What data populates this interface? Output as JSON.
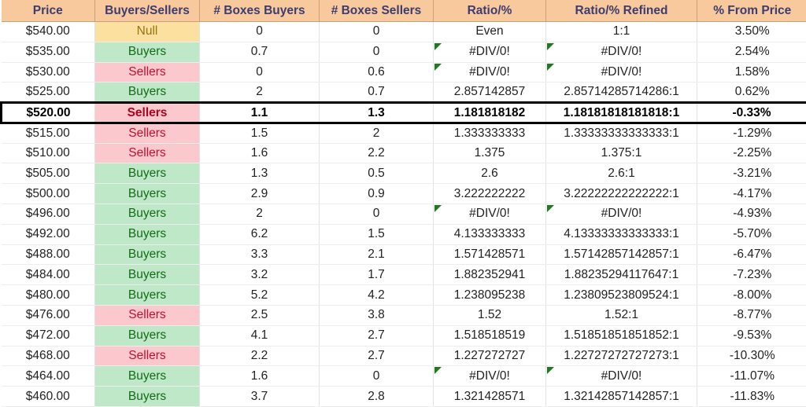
{
  "sheet": {
    "title": "Price Ladder Buyers/Sellers Ratio Table",
    "colors": {
      "header_bg": "#F8C99C",
      "header_text": "#3C3C70",
      "buyers_bg": "#BFE8C8",
      "buyers_text": "#136B16",
      "sellers_bg": "#FBC9CD",
      "sellers_text": "#C01030",
      "null_bg": "#FBE0A0",
      "null_text": "#97750E",
      "error_flag": "#1D7A1D",
      "highlight_border": "#000000"
    }
  },
  "columns": [
    {
      "key": "price",
      "label": "Price"
    },
    {
      "key": "side",
      "label": "Buyers/Sellers"
    },
    {
      "key": "boxes_buy",
      "label": "# Boxes Buyers"
    },
    {
      "key": "boxes_sell",
      "label": "# Boxes Sellers"
    },
    {
      "key": "ratio",
      "label": "Ratio/%"
    },
    {
      "key": "ratio_ref",
      "label": "Ratio/% Refined"
    },
    {
      "key": "from_price",
      "label": "% From Price"
    }
  ],
  "rows": [
    {
      "price": "$540.00",
      "side": "Null",
      "side_fill": "null",
      "boxes_buy": "0",
      "boxes_sell": "0",
      "ratio": "Even",
      "ratio_error": false,
      "ratio_ref": "1:1",
      "ratio_ref_error": false,
      "from_price": "3.50%",
      "highlight": false
    },
    {
      "price": "$535.00",
      "side": "Buyers",
      "side_fill": "buyers",
      "boxes_buy": "0.7",
      "boxes_sell": "0",
      "ratio": "#DIV/0!",
      "ratio_error": true,
      "ratio_ref": "#DIV/0!",
      "ratio_ref_error": true,
      "from_price": "2.54%",
      "highlight": false
    },
    {
      "price": "$530.00",
      "side": "Sellers",
      "side_fill": "sellers",
      "boxes_buy": "0",
      "boxes_sell": "0.6",
      "ratio": "#DIV/0!",
      "ratio_error": true,
      "ratio_ref": "#DIV/0!",
      "ratio_ref_error": true,
      "from_price": "1.58%",
      "highlight": false
    },
    {
      "price": "$525.00",
      "side": "Buyers",
      "side_fill": "buyers",
      "boxes_buy": "2",
      "boxes_sell": "0.7",
      "ratio": "2.857142857",
      "ratio_error": false,
      "ratio_ref": "2.85714285714286:1",
      "ratio_ref_error": false,
      "from_price": "0.62%",
      "highlight": false
    },
    {
      "price": "$520.00",
      "side": "Sellers",
      "side_fill": "sellers",
      "boxes_buy": "1.1",
      "boxes_sell": "1.3",
      "ratio": "1.181818182",
      "ratio_error": false,
      "ratio_ref": "1.18181818181818:1",
      "ratio_ref_error": false,
      "from_price": "-0.33%",
      "highlight": true
    },
    {
      "price": "$515.00",
      "side": "Sellers",
      "side_fill": "sellers",
      "boxes_buy": "1.5",
      "boxes_sell": "2",
      "ratio": "1.333333333",
      "ratio_error": false,
      "ratio_ref": "1.33333333333333:1",
      "ratio_ref_error": false,
      "from_price": "-1.29%",
      "highlight": false
    },
    {
      "price": "$510.00",
      "side": "Sellers",
      "side_fill": "sellers",
      "boxes_buy": "1.6",
      "boxes_sell": "2.2",
      "ratio": "1.375",
      "ratio_error": false,
      "ratio_ref": "1.375:1",
      "ratio_ref_error": false,
      "from_price": "-2.25%",
      "highlight": false
    },
    {
      "price": "$505.00",
      "side": "Buyers",
      "side_fill": "buyers",
      "boxes_buy": "1.3",
      "boxes_sell": "0.5",
      "ratio": "2.6",
      "ratio_error": false,
      "ratio_ref": "2.6:1",
      "ratio_ref_error": false,
      "from_price": "-3.21%",
      "highlight": false
    },
    {
      "price": "$500.00",
      "side": "Buyers",
      "side_fill": "buyers",
      "boxes_buy": "2.9",
      "boxes_sell": "0.9",
      "ratio": "3.222222222",
      "ratio_error": false,
      "ratio_ref": "3.22222222222222:1",
      "ratio_ref_error": false,
      "from_price": "-4.17%",
      "highlight": false
    },
    {
      "price": "$496.00",
      "side": "Buyers",
      "side_fill": "buyers",
      "boxes_buy": "2",
      "boxes_sell": "0",
      "ratio": "#DIV/0!",
      "ratio_error": true,
      "ratio_ref": "#DIV/0!",
      "ratio_ref_error": true,
      "from_price": "-4.93%",
      "highlight": false
    },
    {
      "price": "$492.00",
      "side": "Buyers",
      "side_fill": "buyers",
      "boxes_buy": "6.2",
      "boxes_sell": "1.5",
      "ratio": "4.133333333",
      "ratio_error": false,
      "ratio_ref": "4.13333333333333:1",
      "ratio_ref_error": false,
      "from_price": "-5.70%",
      "highlight": false
    },
    {
      "price": "$488.00",
      "side": "Buyers",
      "side_fill": "buyers",
      "boxes_buy": "3.3",
      "boxes_sell": "2.1",
      "ratio": "1.571428571",
      "ratio_error": false,
      "ratio_ref": "1.57142857142857:1",
      "ratio_ref_error": false,
      "from_price": "-6.47%",
      "highlight": false
    },
    {
      "price": "$484.00",
      "side": "Buyers",
      "side_fill": "buyers",
      "boxes_buy": "3.2",
      "boxes_sell": "1.7",
      "ratio": "1.882352941",
      "ratio_error": false,
      "ratio_ref": "1.88235294117647:1",
      "ratio_ref_error": false,
      "from_price": "-7.23%",
      "highlight": false
    },
    {
      "price": "$480.00",
      "side": "Buyers",
      "side_fill": "buyers",
      "boxes_buy": "5.2",
      "boxes_sell": "4.2",
      "ratio": "1.238095238",
      "ratio_error": false,
      "ratio_ref": "1.23809523809524:1",
      "ratio_ref_error": false,
      "from_price": "-8.00%",
      "highlight": false
    },
    {
      "price": "$476.00",
      "side": "Sellers",
      "side_fill": "sellers",
      "boxes_buy": "2.5",
      "boxes_sell": "3.8",
      "ratio": "1.52",
      "ratio_error": false,
      "ratio_ref": "1.52:1",
      "ratio_ref_error": false,
      "from_price": "-8.77%",
      "highlight": false
    },
    {
      "price": "$472.00",
      "side": "Buyers",
      "side_fill": "buyers",
      "boxes_buy": "4.1",
      "boxes_sell": "2.7",
      "ratio": "1.518518519",
      "ratio_error": false,
      "ratio_ref": "1.51851851851852:1",
      "ratio_ref_error": false,
      "from_price": "-9.53%",
      "highlight": false
    },
    {
      "price": "$468.00",
      "side": "Sellers",
      "side_fill": "sellers",
      "boxes_buy": "2.2",
      "boxes_sell": "2.7",
      "ratio": "1.227272727",
      "ratio_error": false,
      "ratio_ref": "1.22727272727273:1",
      "ratio_ref_error": false,
      "from_price": "-10.30%",
      "highlight": false
    },
    {
      "price": "$464.00",
      "side": "Buyers",
      "side_fill": "buyers",
      "boxes_buy": "1.6",
      "boxes_sell": "0",
      "ratio": "#DIV/0!",
      "ratio_error": true,
      "ratio_ref": "#DIV/0!",
      "ratio_ref_error": true,
      "from_price": "-11.07%",
      "highlight": false
    },
    {
      "price": "$460.00",
      "side": "Buyers",
      "side_fill": "buyers",
      "boxes_buy": "3.7",
      "boxes_sell": "2.8",
      "ratio": "1.321428571",
      "ratio_error": false,
      "ratio_ref": "1.32142857142857:1",
      "ratio_ref_error": false,
      "from_price": "-11.83%",
      "highlight": false
    }
  ]
}
